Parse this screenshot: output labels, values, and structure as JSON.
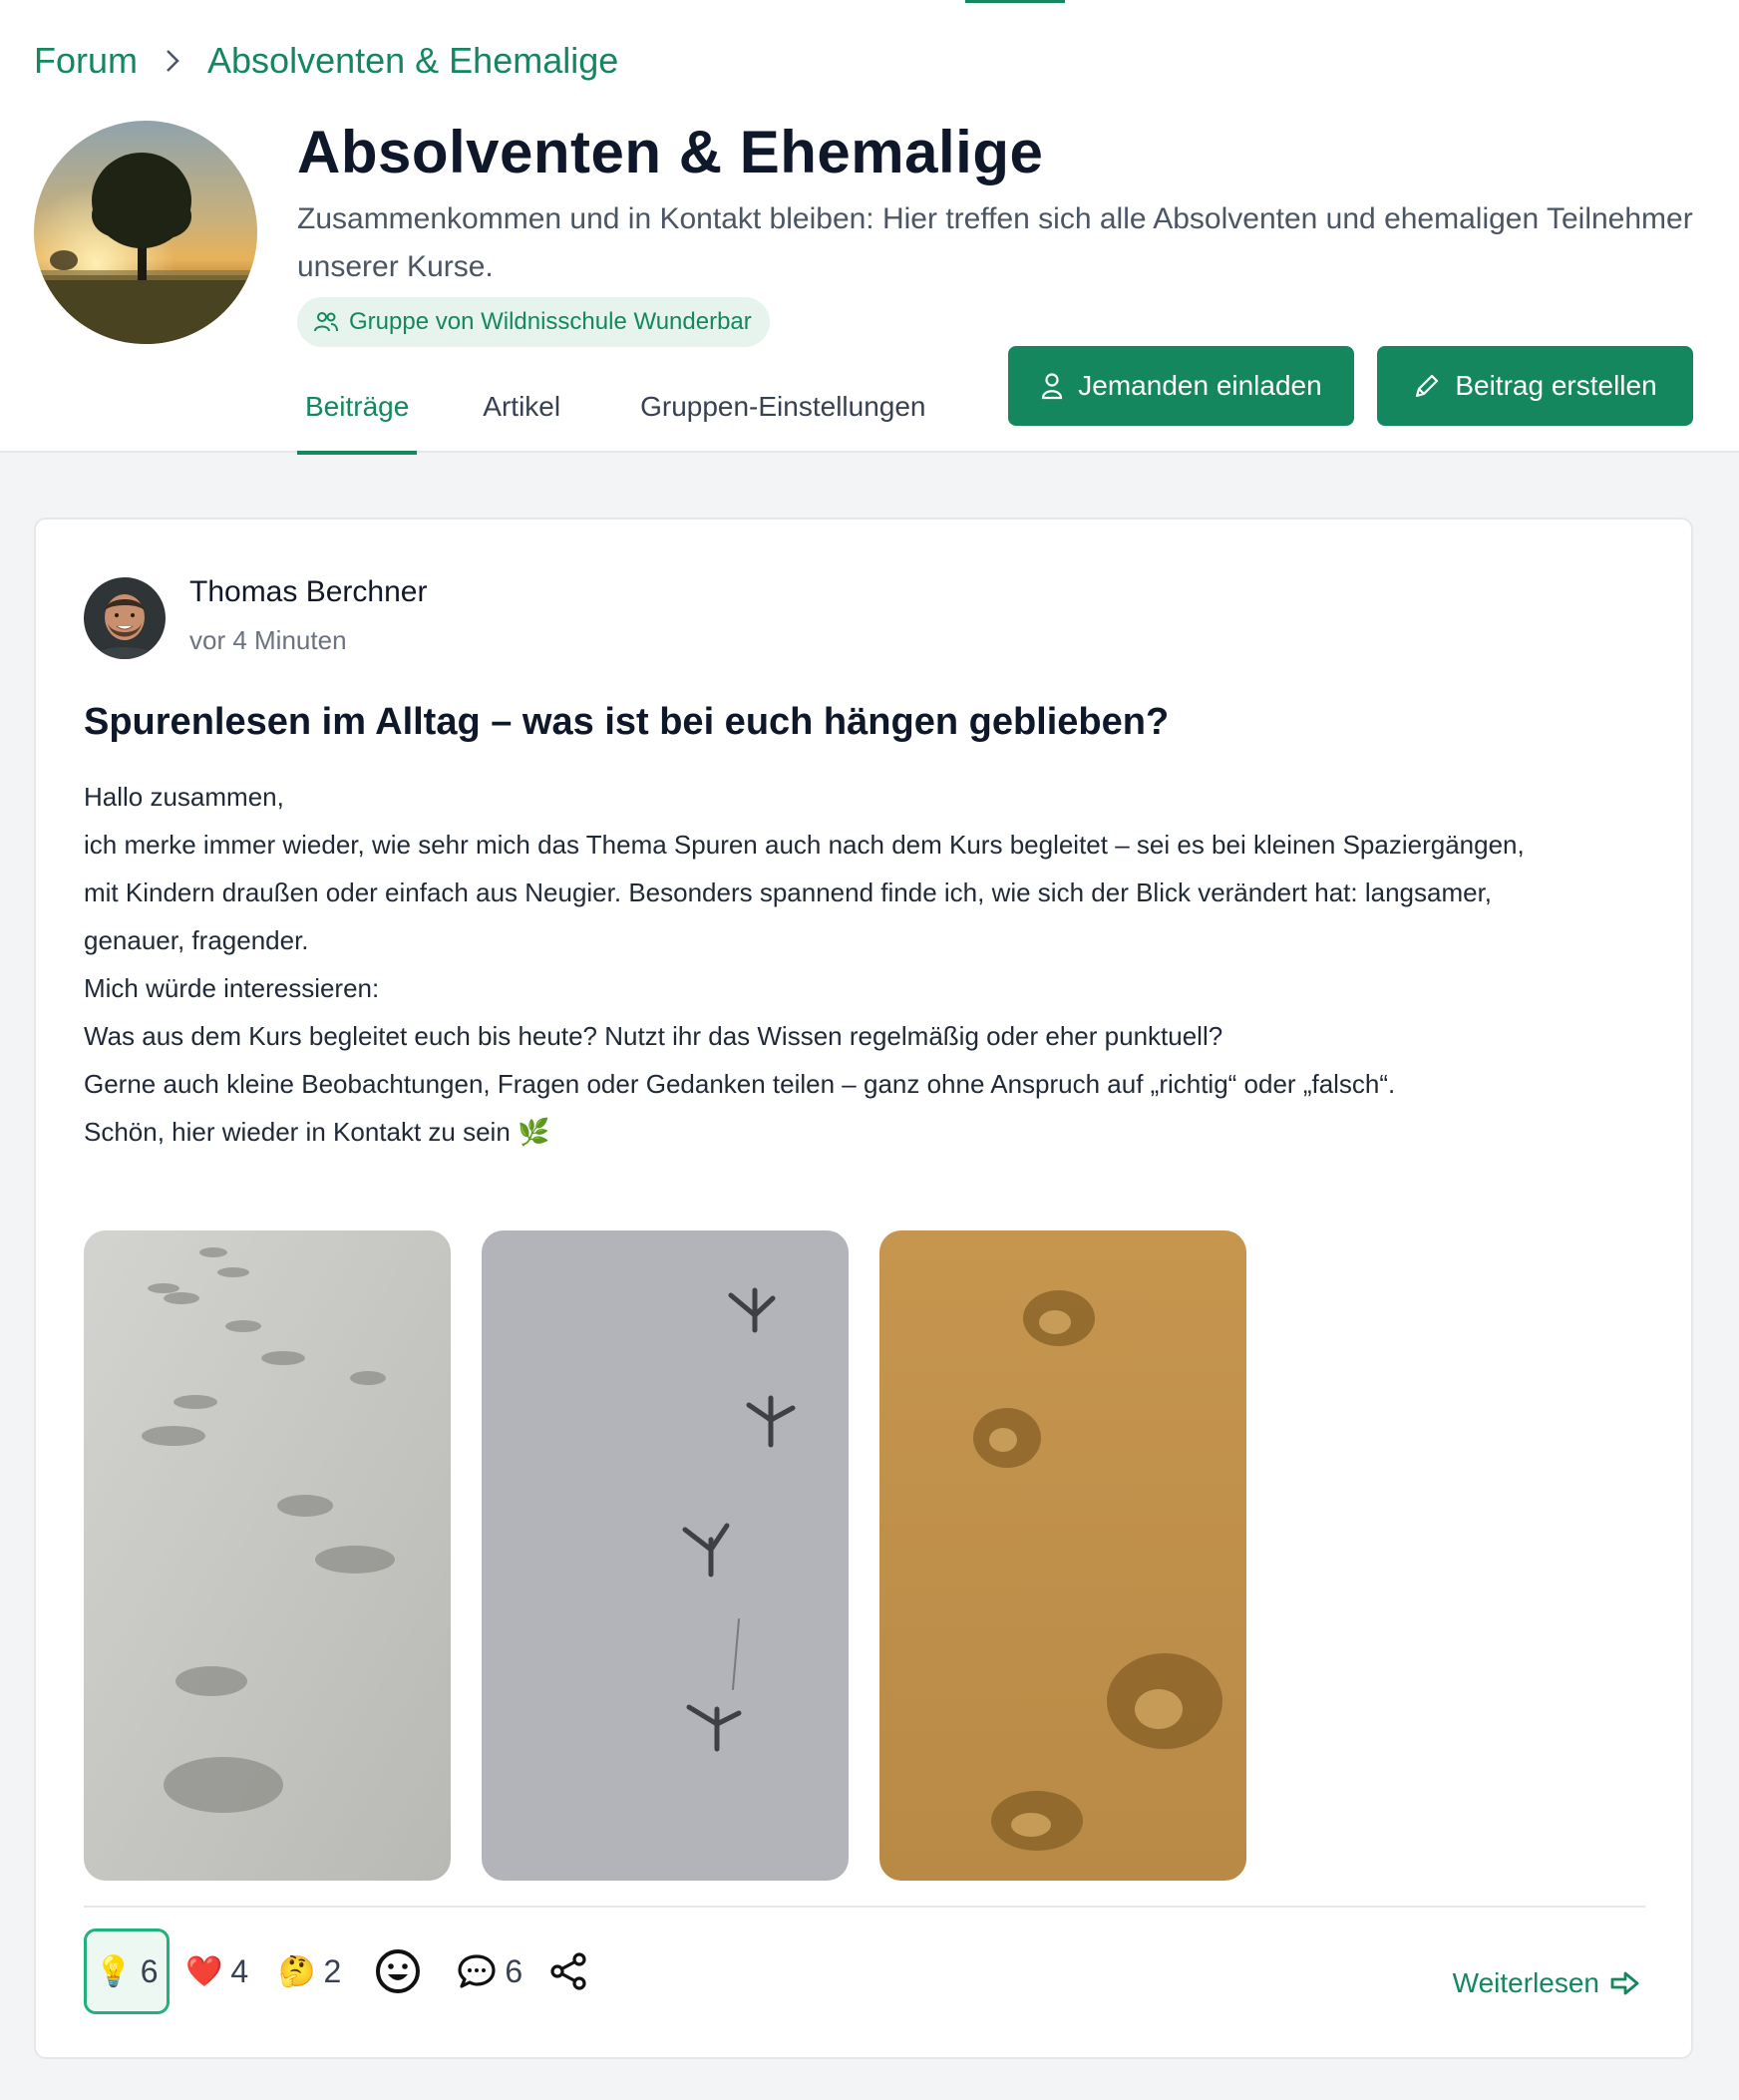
{
  "breadcrumb": {
    "root": "Forum",
    "current": "Absolventen & Ehemalige"
  },
  "group": {
    "title": "Absolventen & Ehemalige",
    "description": "Zusammenkommen und in Kontakt bleiben: Hier treffen sich alle Absolventen und ehemaligen Teilnehmer unserer Kurse.",
    "badge": "Gruppe von Wildnisschule Wunderbar"
  },
  "tabs": [
    {
      "label": "Beiträge",
      "active": true
    },
    {
      "label": "Artikel",
      "active": false
    },
    {
      "label": "Gruppen-Einstellungen",
      "active": false
    }
  ],
  "actions": {
    "invite": "Jemanden einladen",
    "create": "Beitrag erstellen"
  },
  "post": {
    "author": "Thomas Berchner",
    "time": "vor 4 Minuten",
    "title": "Spurenlesen im Alltag – was ist bei euch hängen geblieben?",
    "body": [
      "Hallo zusammen,",
      "ich merke immer wieder, wie sehr mich das Thema Spuren auch nach dem Kurs begleitet – sei es bei kleinen Spaziergängen,",
      "mit Kindern draußen oder einfach aus Neugier. Besonders spannend finde ich, wie sich der Blick verändert hat: langsamer,",
      "genauer, fragender.",
      "Mich würde interessieren:",
      "Was aus dem Kurs begleitet euch bis heute? Nutzt ihr das Wissen regelmäßig oder eher punktuell?",
      "Gerne auch kleine Beobachtungen, Fragen oder Gedanken teilen – ganz ohne Anspruch auf „richtig“ oder „falsch“.",
      "Schön, hier wieder in Kontakt zu sein 🌿"
    ],
    "reactions": {
      "idea": {
        "emoji": "💡",
        "count": "6"
      },
      "heart": {
        "emoji": "❤️",
        "count": "4"
      },
      "thinking": {
        "emoji": "🤔",
        "count": "2"
      },
      "comments": "6"
    },
    "read_more": "Weiterlesen"
  },
  "colors": {
    "accent": "#14875e",
    "badge_bg": "#e6f4ed",
    "selected_border": "#22b07d"
  }
}
